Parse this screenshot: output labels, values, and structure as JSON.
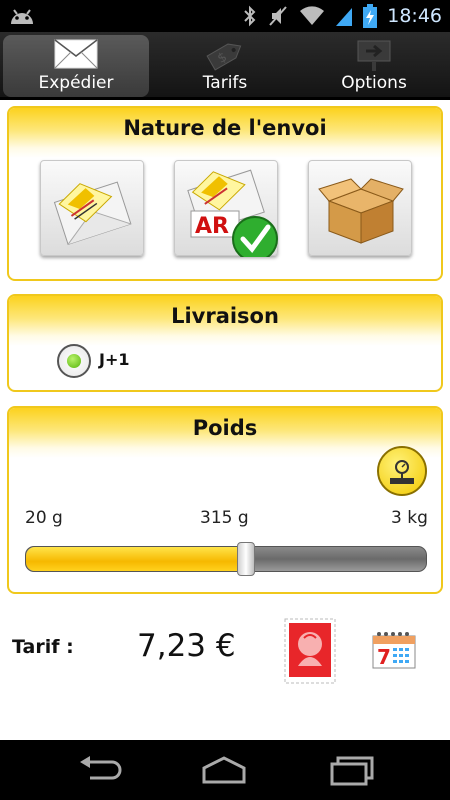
{
  "status_bar": {
    "time": "18:46",
    "icons": [
      "android-icon",
      "bluetooth-icon",
      "mute-icon",
      "wifi-icon",
      "signal-icon",
      "battery-charging-icon"
    ]
  },
  "tabs": [
    {
      "label": "Expédier",
      "icon": "envelope-icon",
      "active": true
    },
    {
      "label": "Tarifs",
      "icon": "price-tag-icon",
      "active": false
    },
    {
      "label": "Options",
      "icon": "options-signpost-icon",
      "active": false
    }
  ],
  "nature": {
    "title": "Nature de l'envoi",
    "options": [
      {
        "icon": "letter-envelope-icon",
        "selected": false
      },
      {
        "icon": "registered-letter-ar-icon",
        "badge": "AR",
        "selected": true
      },
      {
        "icon": "parcel-box-icon",
        "selected": false
      }
    ]
  },
  "livraison": {
    "title": "Livraison",
    "option_label": "J+1",
    "selected": true
  },
  "poids": {
    "title": "Poids",
    "min_label": "20 g",
    "current_label": "315 g",
    "max_label": "3 kg",
    "slider_fraction": 0.55
  },
  "tarif": {
    "label": "Tarif :",
    "value": "7,23 €"
  },
  "colors": {
    "accent_yellow": "#f6c200",
    "card_border": "#f0c81c",
    "check_green": "#2fae2f"
  },
  "nav": [
    "back-icon",
    "home-icon",
    "recent-apps-icon"
  ]
}
